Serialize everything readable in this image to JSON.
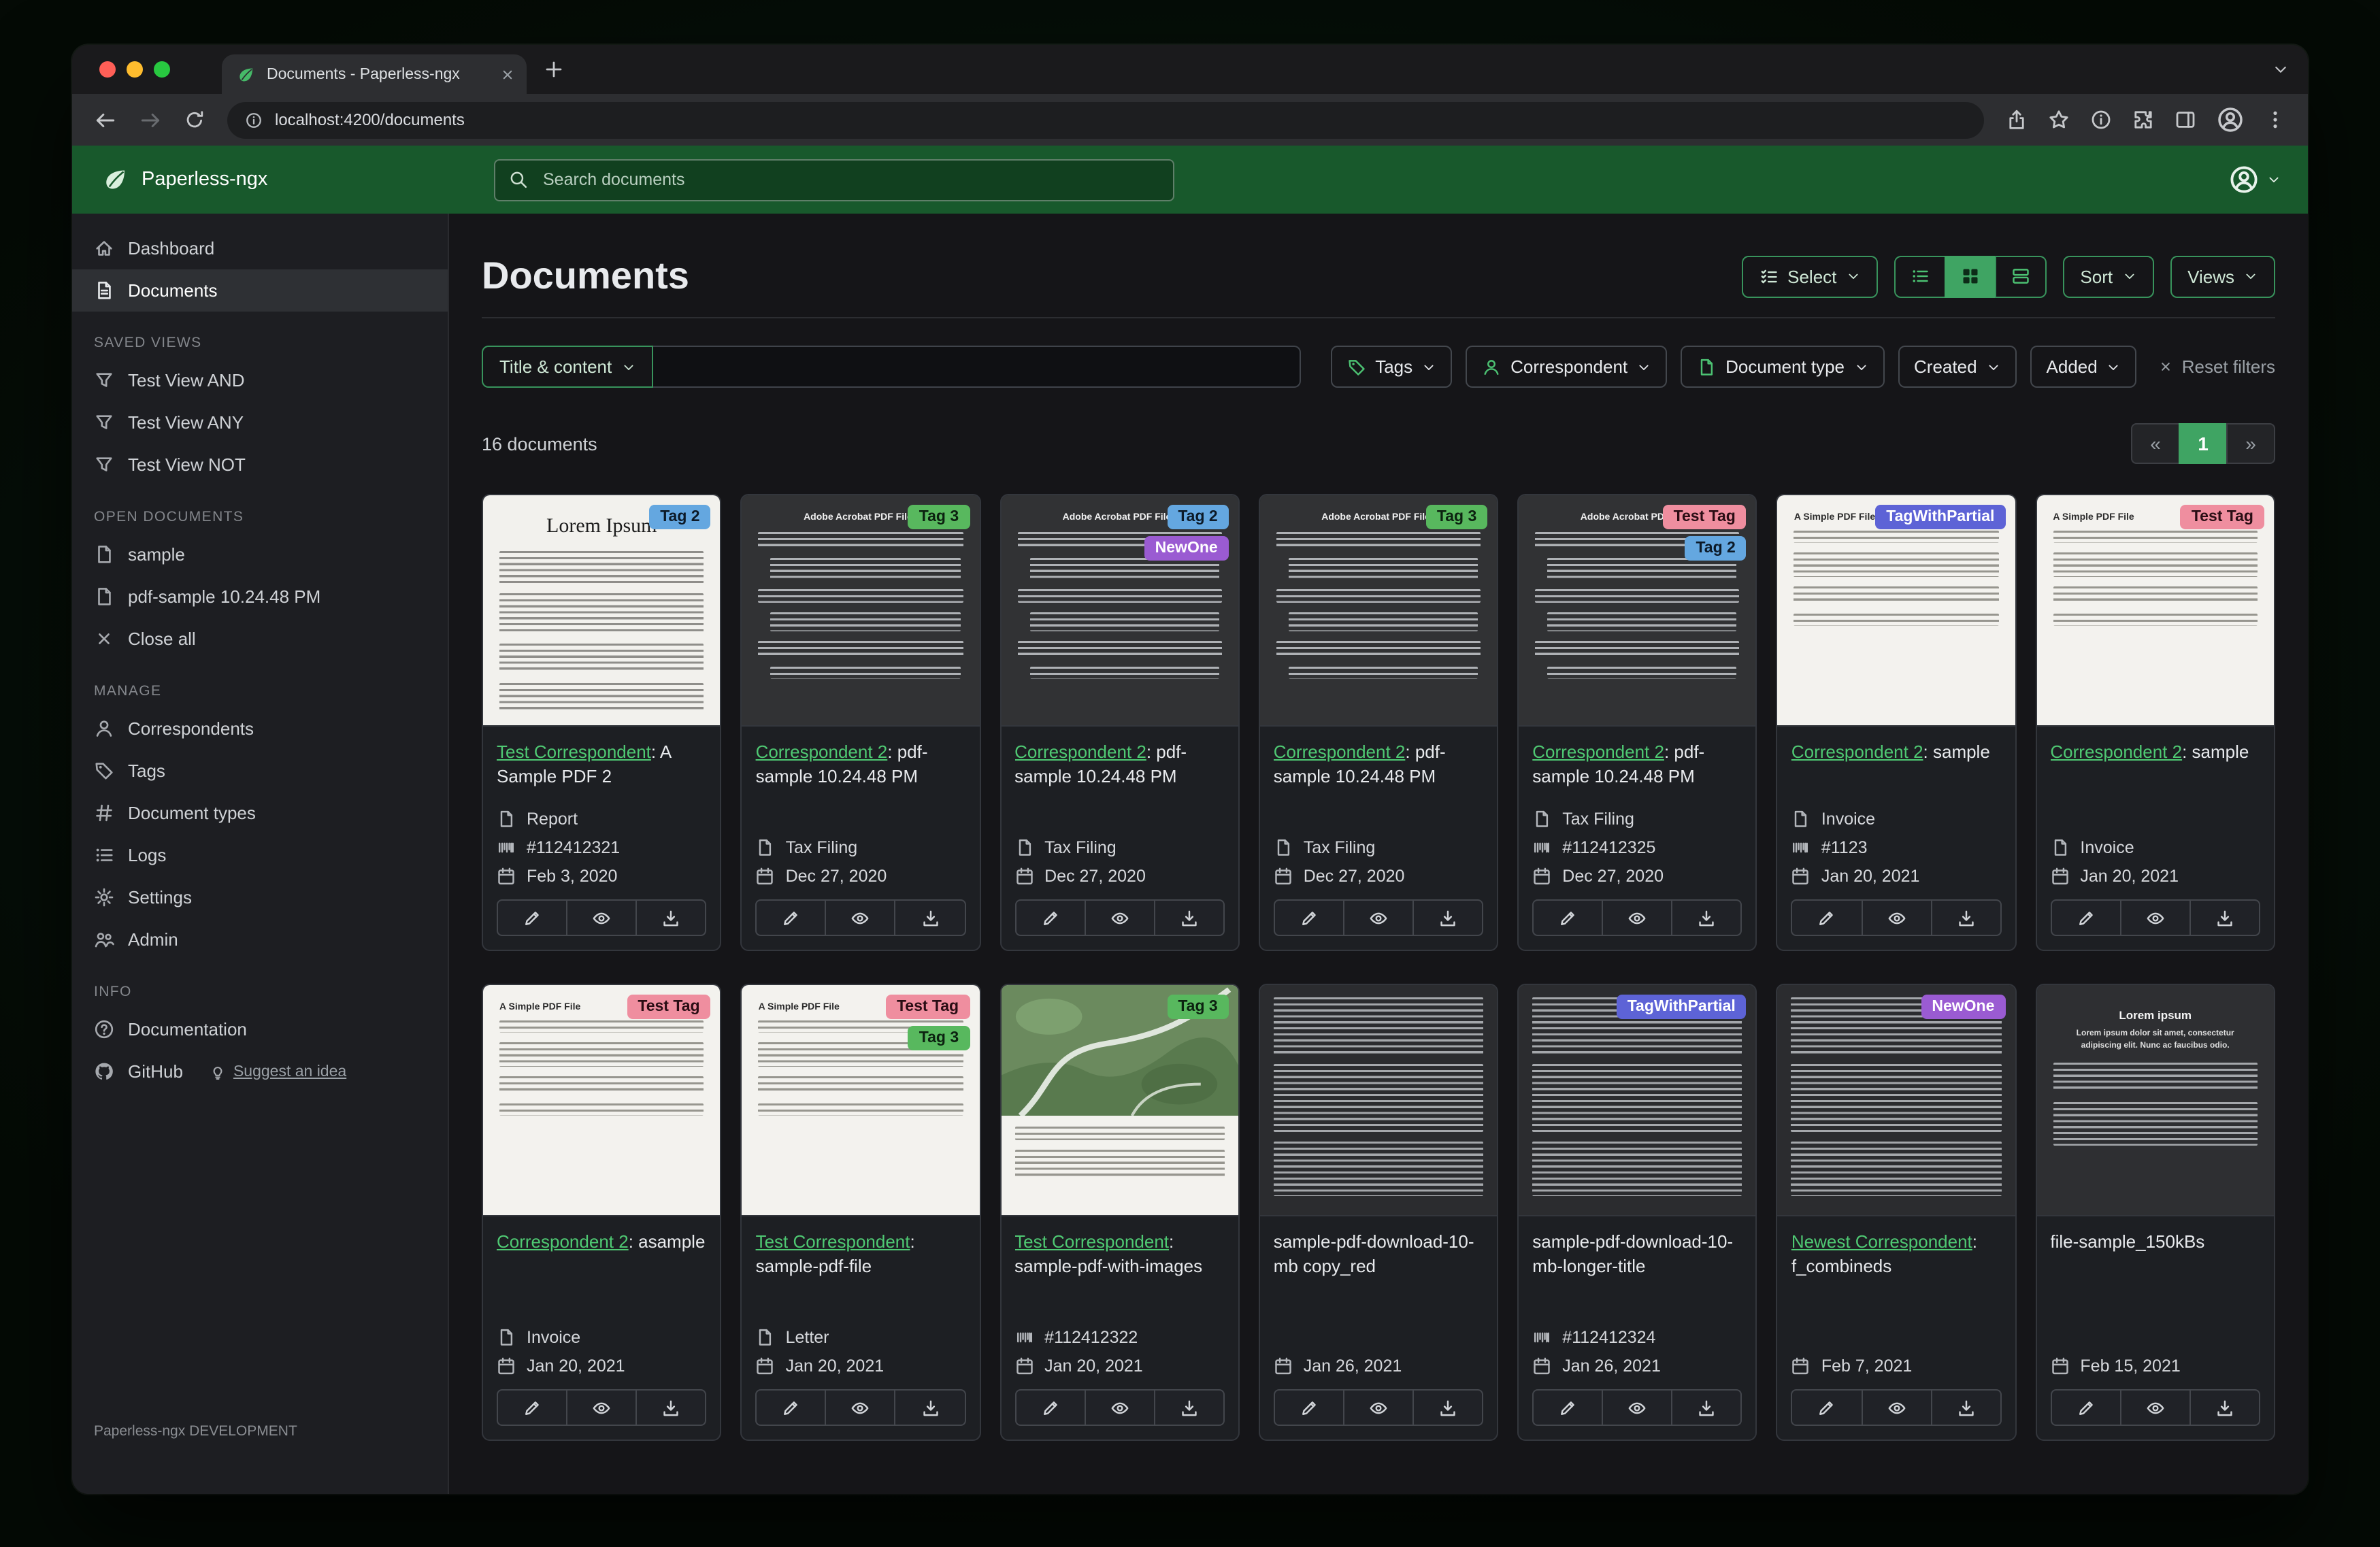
{
  "browser": {
    "tab_title": "Documents - Paperless-ngx",
    "url": "localhost:4200/documents"
  },
  "navbar": {
    "brand": "Paperless-ngx",
    "search_placeholder": "Search documents"
  },
  "sidebar": {
    "primary": [
      {
        "label": "Dashboard",
        "icon": "home"
      },
      {
        "label": "Documents",
        "icon": "files",
        "active": true
      }
    ],
    "sections": [
      {
        "title": "SAVED VIEWS",
        "items": [
          {
            "label": "Test View AND",
            "icon": "funnel"
          },
          {
            "label": "Test View ANY",
            "icon": "funnel"
          },
          {
            "label": "Test View NOT",
            "icon": "funnel"
          }
        ]
      },
      {
        "title": "OPEN DOCUMENTS",
        "items": [
          {
            "label": "sample",
            "icon": "filetext"
          },
          {
            "label": "pdf-sample 10.24.48 PM",
            "icon": "filetext"
          },
          {
            "label": "Close all",
            "icon": "x"
          }
        ]
      },
      {
        "title": "MANAGE",
        "items": [
          {
            "label": "Correspondents",
            "icon": "person"
          },
          {
            "label": "Tags",
            "icon": "tag"
          },
          {
            "label": "Document types",
            "icon": "hash"
          },
          {
            "label": "Logs",
            "icon": "listicon"
          },
          {
            "label": "Settings",
            "icon": "gear"
          },
          {
            "label": "Admin",
            "icon": "people"
          }
        ]
      },
      {
        "title": "INFO",
        "items": [
          {
            "label": "Documentation",
            "icon": "question"
          },
          {
            "label": "GitHub",
            "icon": "github",
            "suffix": {
              "label": "Suggest an idea",
              "icon": "bulb"
            }
          }
        ]
      }
    ],
    "footer": "Paperless-ngx DEVELOPMENT"
  },
  "content": {
    "title": "Documents",
    "select_label": "Select",
    "sort_label": "Sort",
    "views_label": "Views",
    "filter_field_label": "Title & content",
    "filter_buttons": [
      {
        "label": "Tags",
        "icon": "tag"
      },
      {
        "label": "Correspondent",
        "icon": "person"
      },
      {
        "label": "Document type",
        "icon": "filetext"
      },
      {
        "label": "Created"
      },
      {
        "label": "Added"
      }
    ],
    "reset_label": "Reset filters",
    "count_label": "16 documents",
    "pagination": {
      "prev": "«",
      "page": "1",
      "next": "»"
    }
  },
  "tag_colors": {
    "Tag 2": {
      "bg": "#64a7e0",
      "fg": "#0c1a28"
    },
    "Tag 3": {
      "bg": "#58b85e",
      "fg": "#0c2210"
    },
    "NewOne": {
      "bg": "#9a5bd2",
      "fg": "#ffffff"
    },
    "Test Tag": {
      "bg": "#ef8e9f",
      "fg": "#2a0d14"
    },
    "TagWithPartial": {
      "bg": "#5d63d6",
      "fg": "#ffffff"
    }
  },
  "documents": [
    {
      "tags": [
        "Tag 2"
      ],
      "correspondent": "Test Correspondent",
      "title_rest": ": A Sample PDF 2",
      "doc_type": "Report",
      "asn": "#112412321",
      "date": "Feb 3, 2020",
      "thumb": "lorem-light",
      "thumb_heading": "Lorem Ipsum"
    },
    {
      "tags": [
        "Tag 3"
      ],
      "correspondent": "Correspondent 2",
      "title_rest": ": pdf-sample 10.24.48 PM",
      "doc_type": "Tax Filing",
      "date": "Dec 27, 2020",
      "thumb": "acrobat-dark",
      "thumb_heading": "Adobe Acrobat PDF Files"
    },
    {
      "tags": [
        "Tag 2",
        "NewOne"
      ],
      "correspondent": "Correspondent 2",
      "title_rest": ": pdf-sample 10.24.48 PM",
      "doc_type": "Tax Filing",
      "date": "Dec 27, 2020",
      "thumb": "acrobat-dark",
      "thumb_heading": "Adobe Acrobat PDF Files"
    },
    {
      "tags": [
        "Tag 3"
      ],
      "correspondent": "Correspondent 2",
      "title_rest": ": pdf-sample 10.24.48 PM",
      "doc_type": "Tax Filing",
      "date": "Dec 27, 2020",
      "thumb": "acrobat-dark",
      "thumb_heading": "Adobe Acrobat PDF Files"
    },
    {
      "tags": [
        "Test Tag",
        "Tag 2"
      ],
      "correspondent": "Correspondent 2",
      "title_rest": ": pdf-sample 10.24.48 PM",
      "doc_type": "Tax Filing",
      "asn": "#112412325",
      "date": "Dec 27, 2020",
      "thumb": "acrobat-dark",
      "thumb_heading": "Adobe Acrobat PDF Files"
    },
    {
      "tags": [
        "TagWithPartial"
      ],
      "correspondent": "Correspondent 2",
      "title_rest": ": sample",
      "doc_type": "Invoice",
      "asn": "#1123",
      "date": "Jan 20, 2021",
      "thumb": "simple-light",
      "thumb_heading": "A Simple PDF File"
    },
    {
      "tags": [
        "Test Tag"
      ],
      "correspondent": "Correspondent 2",
      "title_rest": ": sample",
      "doc_type": "Invoice",
      "date": "Jan 20, 2021",
      "thumb": "simple-light",
      "thumb_heading": "A Simple PDF File"
    },
    {
      "tags": [
        "Test Tag"
      ],
      "correspondent": "Correspondent 2",
      "title_rest": ": asample",
      "doc_type": "Invoice",
      "date": "Jan 20, 2021",
      "thumb": "simple-light",
      "thumb_heading": "A Simple PDF File"
    },
    {
      "tags": [
        "Test Tag",
        "Tag 3"
      ],
      "correspondent": "Test Correspondent",
      "title_rest": ": sample-pdf-file",
      "doc_type": "Letter",
      "date": "Jan 20, 2021",
      "thumb": "simple-light",
      "thumb_heading": "A Simple PDF File"
    },
    {
      "tags": [
        "Tag 3"
      ],
      "correspondent": "Test Correspondent",
      "title_rest": ": sample-pdf-with-images",
      "asn": "#112412322",
      "date": "Jan 20, 2021",
      "thumb": "map",
      "thumb_heading": ""
    },
    {
      "tags": [],
      "title": "sample-pdf-download-10-mb copy_red",
      "date": "Jan 26, 2021",
      "thumb": "dense-dark",
      "thumb_heading": ""
    },
    {
      "tags": [
        "TagWithPartial"
      ],
      "title": "sample-pdf-download-10-mb-longer-title",
      "asn": "#112412324",
      "date": "Jan 26, 2021",
      "thumb": "dense-dark",
      "thumb_heading": ""
    },
    {
      "tags": [
        "NewOne"
      ],
      "correspondent": "Newest Correspondent",
      "title_rest": ": f_combineds",
      "date": "Feb 7, 2021",
      "thumb": "dense-dark",
      "thumb_heading": ""
    },
    {
      "tags": [],
      "title": "file-sample_150kBs",
      "date": "Feb 15, 2021",
      "thumb": "lorem-dark",
      "thumb_heading": "Lorem ipsum",
      "thumb_subheading": "Lorem ipsum dolor sit amet, consectetur adipiscing elit. Nunc ac faucibus odio."
    }
  ]
}
